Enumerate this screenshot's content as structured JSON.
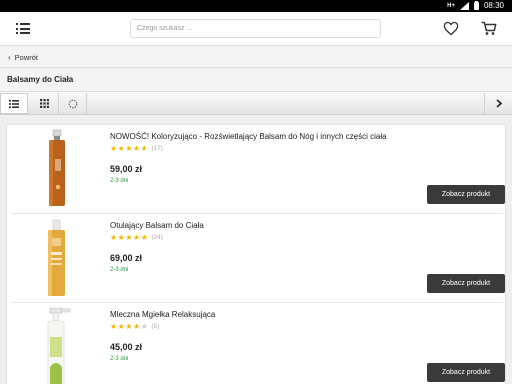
{
  "status": {
    "network": "H+",
    "time": "08:30"
  },
  "header": {
    "search_placeholder": "Czego szukasz ..."
  },
  "nav": {
    "back_label": "Powrót"
  },
  "category": {
    "title": "Balsamy do Ciała"
  },
  "products": [
    {
      "name": "NOWOŚĆ! Koloryzująco - Rozświetlający Balsam do Nóg i innych części ciała",
      "stars": 4.5,
      "reviews": "(17)",
      "price": "59,00 zł",
      "delivery": "2-3 dni",
      "button": "Zobacz produkt"
    },
    {
      "name": "Otulający Balsam do Ciała",
      "stars": 5,
      "reviews": "(24)",
      "price": "69,00 zł",
      "delivery": "2-3 dni",
      "button": "Zobacz produkt"
    },
    {
      "name": "Mleczna Mgiełka Relaksująca",
      "stars": 4,
      "reviews": "(5)",
      "price": "45,00 zł",
      "delivery": "2-3 dni",
      "button": "Zobacz produkt"
    }
  ],
  "colors": {
    "accent": "#3a3a3a",
    "star": "#f3b700",
    "delivery": "#2e9a3e"
  }
}
